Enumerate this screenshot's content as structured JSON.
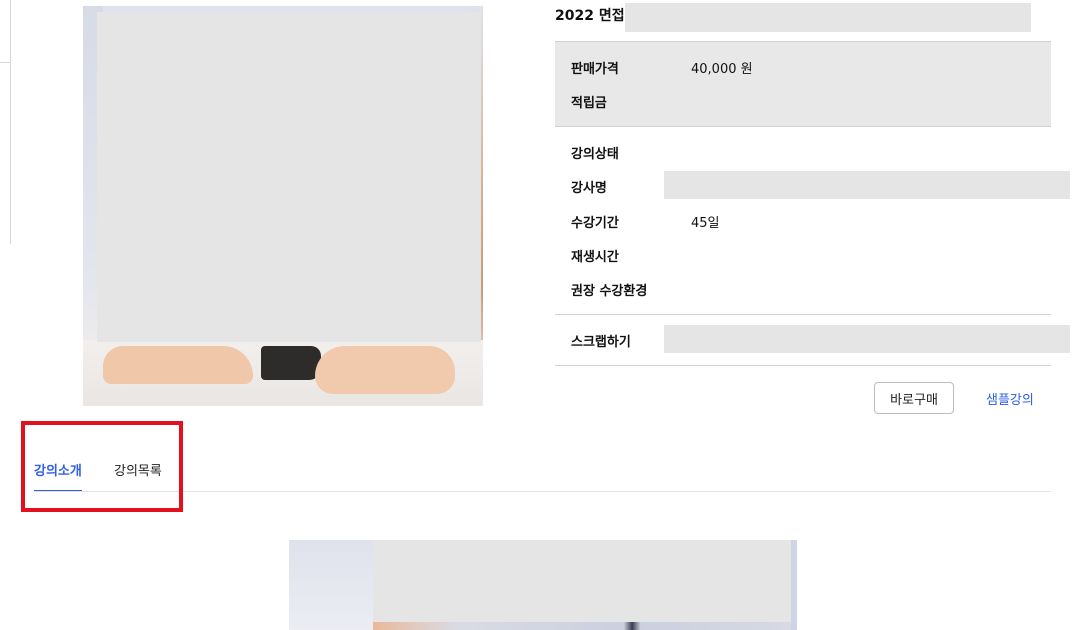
{
  "product": {
    "title": "2022 면접"
  },
  "price_box": {
    "rows": [
      {
        "label": "판매가격",
        "value": "40,000 원"
      },
      {
        "label": "적립금",
        "value": ""
      }
    ]
  },
  "details": {
    "rows": [
      {
        "label": "강의상태",
        "value": ""
      },
      {
        "label": "강사명",
        "value": ""
      },
      {
        "label": "수강기간",
        "value": "45일"
      },
      {
        "label": "재생시간",
        "value": ""
      },
      {
        "label": "권장 수강환경",
        "value": ""
      }
    ]
  },
  "scrap": {
    "label": "스크랩하기"
  },
  "actions": {
    "buy_label": "바로구매",
    "sample_label": "샘플강의"
  },
  "tabs": [
    {
      "label": "강의소개",
      "active": true
    },
    {
      "label": "강의목록",
      "active": false
    }
  ],
  "colors": {
    "accent": "#2f5fe6",
    "highlight": "#e3101e",
    "redaction": "#e5e5e5",
    "price_box_bg": "#e8e8e8"
  }
}
